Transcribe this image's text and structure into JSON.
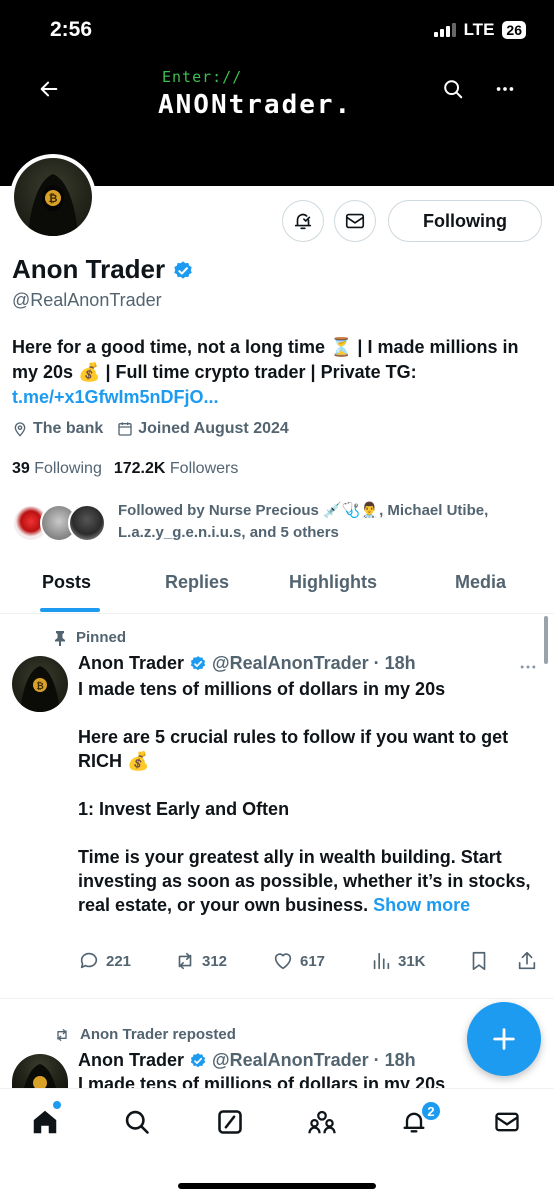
{
  "status_bar": {
    "time": "2:56",
    "network": "LTE",
    "battery": "26"
  },
  "banner": {
    "line1": "Enter://",
    "line2": "ANONtrader."
  },
  "profile": {
    "name": "Anon Trader",
    "handle": "@RealAnonTrader",
    "bio_text": "Here for a good time, not a long time ⏳ | I made millions in my 20s 💰 | Full time crypto trader | Private TG: ",
    "bio_link": "t.me/+x1GfwIm5nDFjO...",
    "location": "The bank",
    "joined": "Joined August 2024",
    "following_count": "39",
    "following_label": "Following",
    "followers_count": "172.2K",
    "followers_label": "Followers",
    "followed_by": "Followed by Nurse Precious 💉🩺👨‍⚕️, Michael Utibe, L.a.z.y_g.e.n.i.u.s, and 5 others",
    "follow_button": "Following"
  },
  "tabs": [
    {
      "label": "Posts",
      "active": true
    },
    {
      "label": "Replies",
      "active": false
    },
    {
      "label": "Highlights",
      "active": false
    },
    {
      "label": "Media",
      "active": false
    }
  ],
  "pinned_post": {
    "pinned_label": "Pinned",
    "author": "Anon Trader",
    "handle_time": "@RealAnonTrader · 18h",
    "para1": "I made tens of millions of dollars in my 20s",
    "para2": "Here are 5 crucial rules to follow if you want to get RICH 💰",
    "para3": "1: Invest Early and Often",
    "para4": "Time is your greatest ally in wealth building. Start investing as soon as possible, whether it’s in stocks, real estate, or your own business.",
    "show_more": "Show more",
    "replies": "221",
    "reposts": "312",
    "likes": "617",
    "views": "31K"
  },
  "second_post": {
    "repost_label": "Anon Trader reposted",
    "author": "Anon Trader",
    "handle_time": "@RealAnonTrader · 18h",
    "text": "I made tens of millions of dollars in my 20s"
  },
  "nav": {
    "notifications_badge": "2"
  },
  "colors": {
    "accent": "#1d9bf0",
    "text": "#0f1419",
    "muted": "#536471"
  }
}
